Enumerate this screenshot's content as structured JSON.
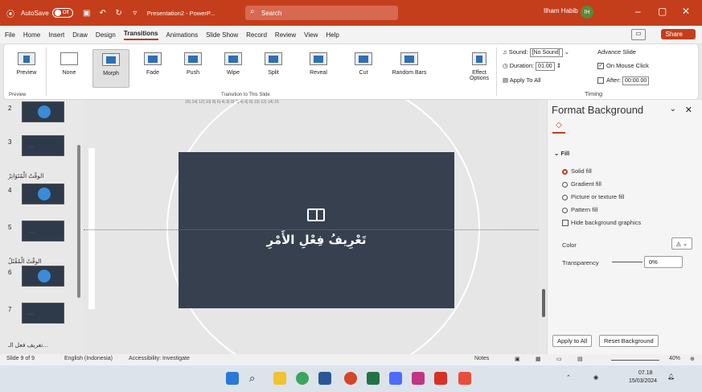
{
  "titlebar": {
    "autosave": "AutoSave",
    "toggle": "Off",
    "filename": "Presentation2 - PowerP...",
    "search_placeholder": "Search",
    "user": "Ilham Habib",
    "avatar_initials": "IH"
  },
  "menu": {
    "items": [
      "File",
      "Home",
      "Insert",
      "Draw",
      "Design",
      "Transitions",
      "Animations",
      "Slide Show",
      "Record",
      "Review",
      "View",
      "Help"
    ],
    "active_index": 5,
    "share": "Share"
  },
  "ribbon": {
    "preview": "Preview",
    "transitions": [
      "None",
      "Morph",
      "Fade",
      "Push",
      "Wipe",
      "Split",
      "Reveal",
      "Cut",
      "Random Bars"
    ],
    "selected": "Morph",
    "effect_options": "Effect Options",
    "group_preview": "Preview",
    "group_transitions": "Transition to This Slide",
    "sound_label": "Sound:",
    "sound_value": "[No Sound]",
    "duration_label": "Duration:",
    "duration_value": "01.00",
    "apply_to_all": "Apply To All",
    "advance_slide": "Advance Slide",
    "on_mouse_click": "On Mouse Click",
    "after_label": "After:",
    "after_value": "00:00.00",
    "group_timing": "Timing"
  },
  "slides": {
    "numbers": [
      "2",
      "3",
      "4",
      "5",
      "6",
      "7"
    ],
    "sections": [
      "الوقْتُ الْمُتَوَاتِرُ",
      "الوقْتُ الْمُقْتَلُ",
      "تعريف فعل الـ..."
    ]
  },
  "canvas": {
    "ruler": "16|·14|·12|·10|·8|·6|·4|·2|·0|·2|·4|·6|·8|·10|·12|·14|·16",
    "slide_title": "تَعْرِيفُ فِعْلِ الأَمْرِ"
  },
  "pane": {
    "title": "Format Background",
    "fill_header": "Fill",
    "options": [
      "Solid fill",
      "Gradient fill",
      "Picture or texture fill",
      "Pattern fill"
    ],
    "hide_bg": "Hide background graphics",
    "color_label": "Color",
    "transparency_label": "Transparency",
    "transparency_value": "0%",
    "apply_all": "Apply to All",
    "reset": "Reset Background"
  },
  "status": {
    "slide": "Slide 9 of 9",
    "language": "English (Indonesia)",
    "accessibility": "Accessibility: Investigate",
    "notes": "Notes",
    "zoom": "40%"
  },
  "taskbar": {
    "time": "07.18",
    "date": "15/03/2024"
  },
  "colors": {
    "accent": "#c43e1c",
    "slide_bg": "#36404f"
  }
}
